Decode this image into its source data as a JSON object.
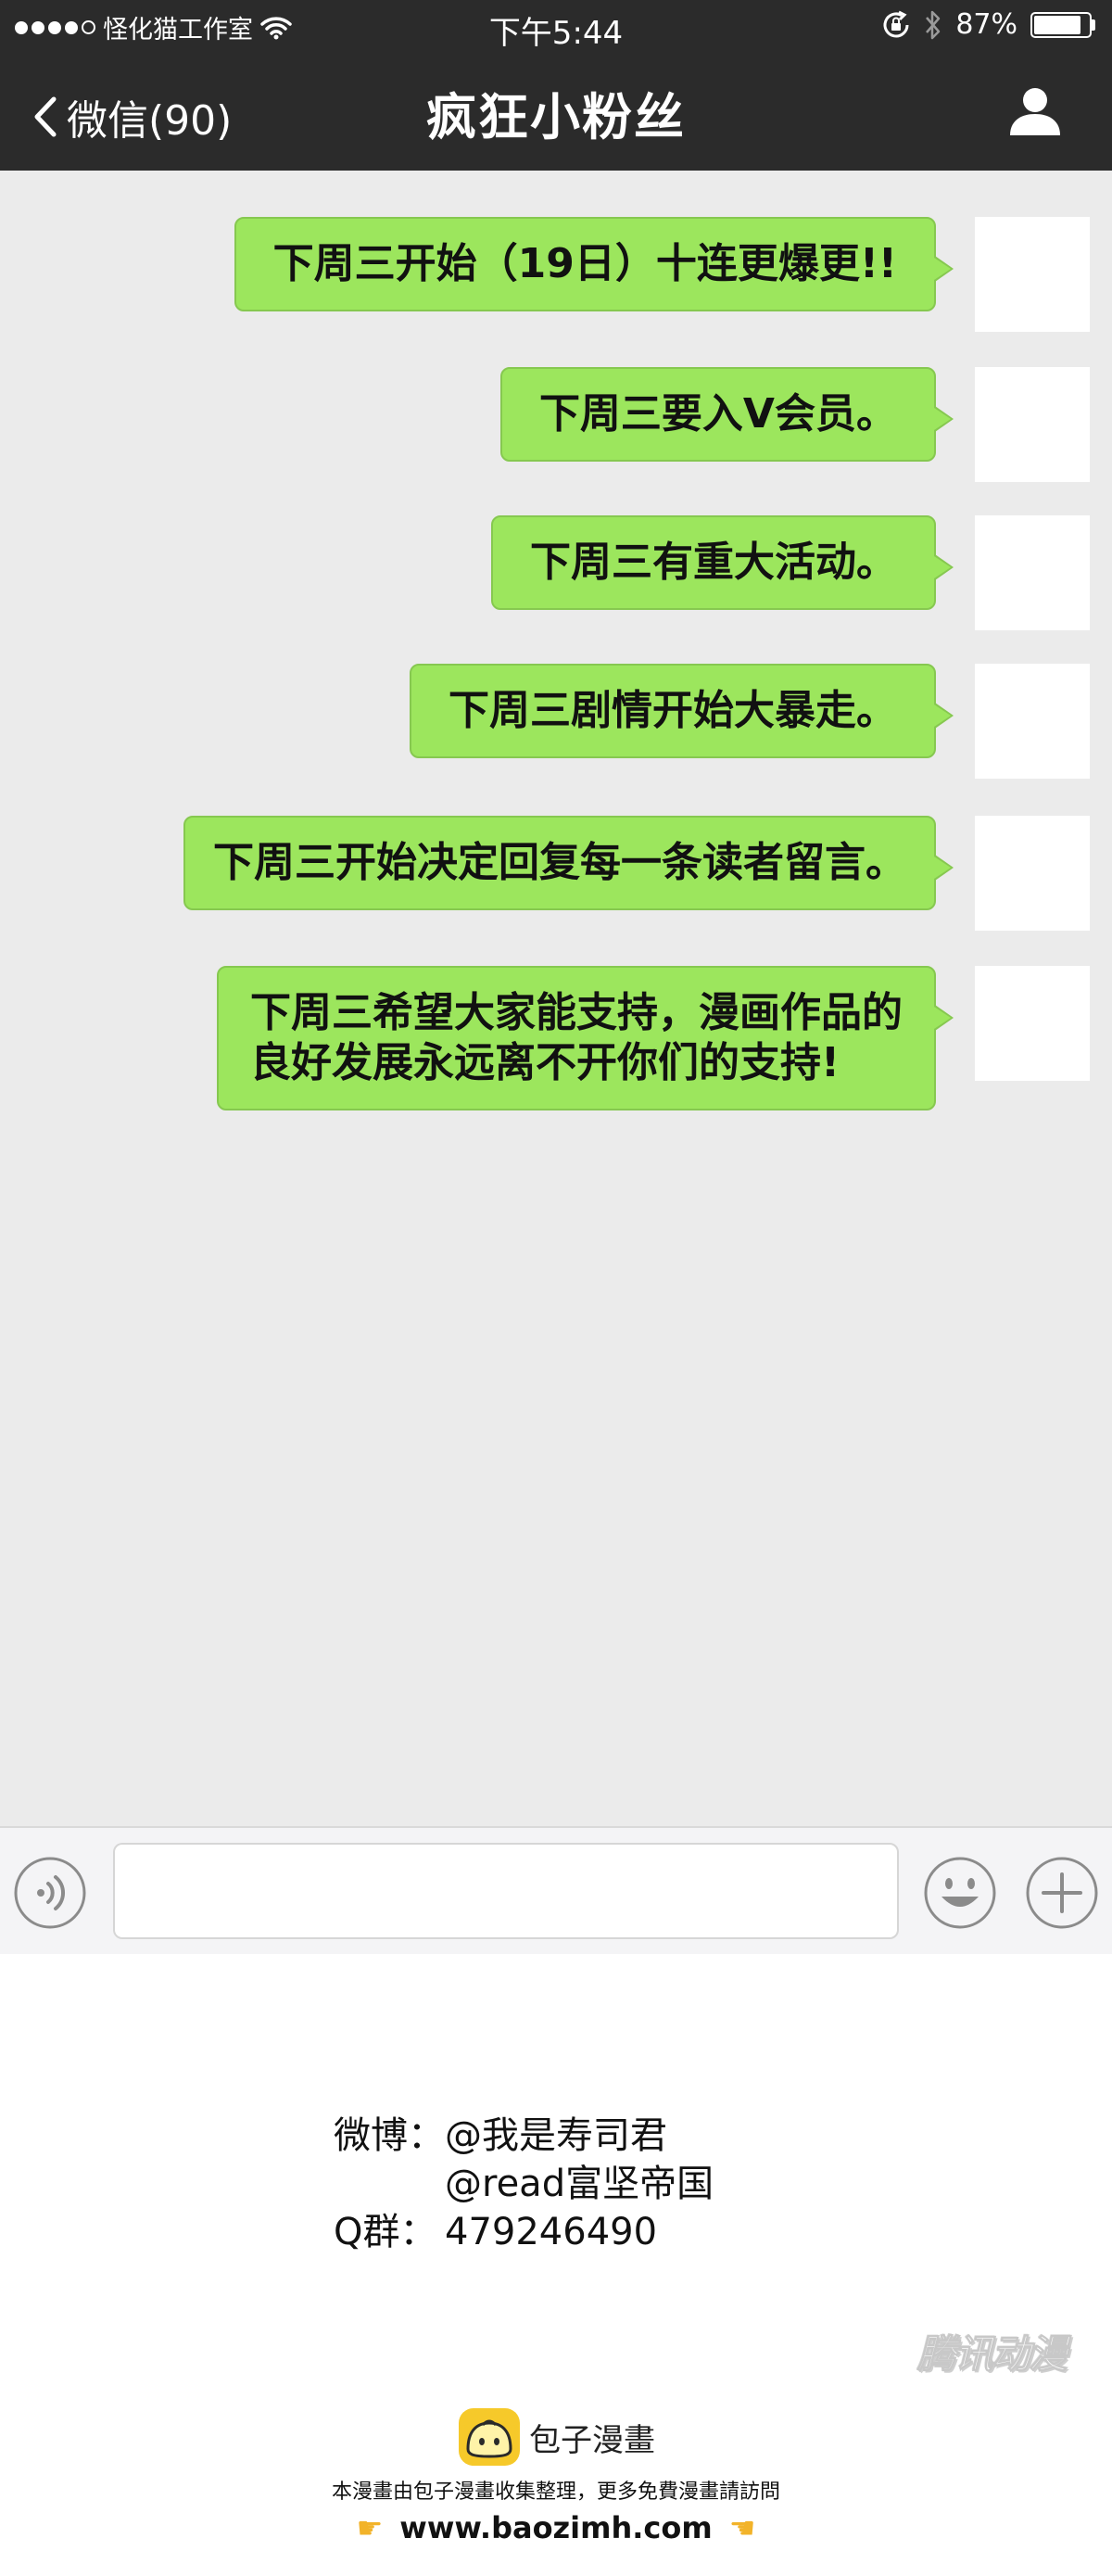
{
  "status_bar": {
    "carrier": "怪化猫工作室",
    "time": "下午5:44",
    "battery_percent_label": "87%",
    "battery_level": 0.87,
    "icons": [
      "signal-dots-icon",
      "wifi-icon",
      "rotation-lock-icon",
      "bluetooth-icon",
      "battery-icon"
    ]
  },
  "nav_bar": {
    "back_label": "微信(90)",
    "title": "疯狂小粉丝",
    "right_icon": "person-icon"
  },
  "chat": {
    "bubble_color": "#9ce65d",
    "background_color": "#ebebeb",
    "messages": [
      {
        "lines": [
          "下周三开始（19日）十连更爆更!!"
        ]
      },
      {
        "lines": [
          "下周三要入V会员。"
        ]
      },
      {
        "lines": [
          "下周三有重大活动。"
        ]
      },
      {
        "lines": [
          "下周三剧情开始大暴走。"
        ]
      },
      {
        "lines": [
          "下周三开始决定回复每一条读者留言。"
        ]
      },
      {
        "lines": [
          "下周三希望大家能支持，漫画作品的",
          "良好发展永远离不开你们的支持!"
        ]
      }
    ]
  },
  "input_bar": {
    "icons": [
      "voice-icon",
      "emoji-icon",
      "plus-icon"
    ],
    "input_value": ""
  },
  "credits": {
    "weibo_label": "微博：",
    "weibo_1": "@我是寿司君",
    "weibo_2": "@read富坚帝国",
    "qq_label": "Q群：",
    "qq_number": "479246490"
  },
  "watermark": {
    "tencent": "腾讯动漫"
  },
  "footer": {
    "brand": "包子漫畫",
    "note": "本漫畫由包子漫畫收集整理，更多免費漫畫請訪問",
    "url": "www.baozimh.com"
  }
}
